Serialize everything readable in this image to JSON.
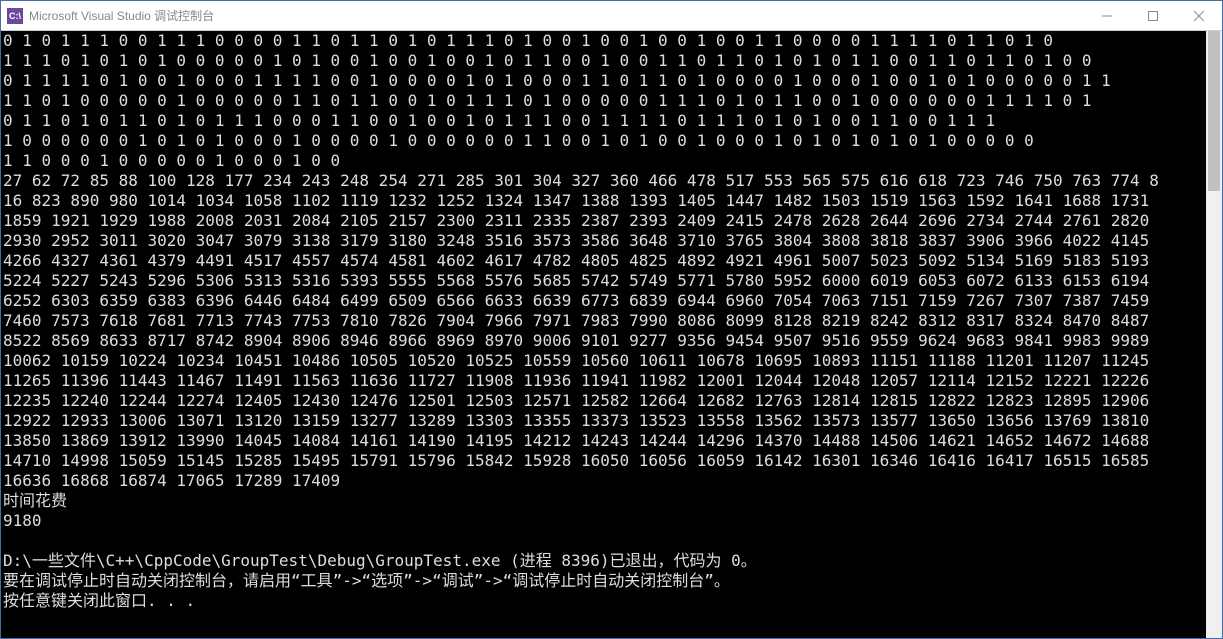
{
  "window": {
    "title": "Microsoft Visual Studio 调试控制台",
    "icon_label": "C:\\"
  },
  "console": {
    "lines": [
      "0 1 0 1 1 1 0 0 1 1 1 0 0 0 0 1 1 0 1 1 0 1 0 1 1 1 0 1 0 0 1 0 0 1 0 0 1 0 0 1 1 0 0 0 0 1 1 1 1 0 1 1 0 1 0",
      "1 1 1 0 1 0 1 0 1 0 0 0 0 0 1 0 1 0 0 1 0 0 1 0 0 1 0 1 1 0 0 1 0 0 1 1 0 1 1 0 1 0 1 0 1 1 0 0 1 1 0 1 1 0 1 0 0",
      "0 1 1 1 1 0 1 0 0 1 0 0 0 1 1 1 1 0 0 1 0 0 0 0 1 0 1 0 0 0 1 1 0 1 1 0 1 0 0 0 0 1 0 0 0 1 0 0 1 0 1 0 0 0 0 0 1 1",
      "1 1 0 1 0 0 0 0 0 1 0 0 0 0 0 1 1 0 1 1 0 0 1 0 1 1 1 0 1 0 0 0 0 0 1 1 1 0 1 0 1 1 0 0 1 0 0 0 0 0 0 1 1 1 1 0 1",
      "0 1 1 0 1 0 1 1 0 1 0 1 1 1 0 0 0 1 1 0 0 1 0 0 1 0 1 1 1 0 0 1 1 1 1 0 1 1 1 0 1 0 1 0 0 1 1 0 0 1 1 1",
      "1 0 0 0 0 0 0 1 0 1 0 1 0 0 0 1 0 0 0 0 1 0 0 0 0 0 0 1 1 0 0 1 0 1 0 0 1 0 0 0 1 0 1 0 1 0 1 0 1 0 0 0 0 0",
      "1 1 0 0 0 1 0 0 0 0 0 1 0 0 0 1 0 0",
      "27 62 72 85 88 100 128 177 234 243 248 254 271 285 301 304 327 360 466 478 517 553 565 575 616 618 723 746 750 763 774 8",
      "16 823 890 980 1014 1034 1058 1102 1119 1232 1252 1324 1347 1388 1393 1405 1447 1482 1503 1519 1563 1592 1641 1688 1731",
      "1859 1921 1929 1988 2008 2031 2084 2105 2157 2300 2311 2335 2387 2393 2409 2415 2478 2628 2644 2696 2734 2744 2761 2820",
      "2930 2952 3011 3020 3047 3079 3138 3179 3180 3248 3516 3573 3586 3648 3710 3765 3804 3808 3818 3837 3906 3966 4022 4145",
      "4266 4327 4361 4379 4491 4517 4557 4574 4581 4602 4617 4782 4805 4825 4892 4921 4961 5007 5023 5092 5134 5169 5183 5193",
      "5224 5227 5243 5296 5306 5313 5316 5393 5555 5568 5576 5685 5742 5749 5771 5780 5952 6000 6019 6053 6072 6133 6153 6194",
      "6252 6303 6359 6383 6396 6446 6484 6499 6509 6566 6633 6639 6773 6839 6944 6960 7054 7063 7151 7159 7267 7307 7387 7459",
      "7460 7573 7618 7681 7713 7743 7753 7810 7826 7904 7966 7971 7983 7990 8086 8099 8128 8219 8242 8312 8317 8324 8470 8487",
      "8522 8569 8633 8717 8742 8904 8906 8946 8966 8969 8970 9006 9101 9277 9356 9454 9507 9516 9559 9624 9683 9841 9983 9989",
      "10062 10159 10224 10234 10451 10486 10505 10520 10525 10559 10560 10611 10678 10695 10893 11151 11188 11201 11207 11245",
      "11265 11396 11443 11467 11491 11563 11636 11727 11908 11936 11941 11982 12001 12044 12048 12057 12114 12152 12221 12226",
      "12235 12240 12244 12274 12405 12430 12476 12501 12503 12571 12582 12664 12682 12763 12814 12815 12822 12823 12895 12906",
      "12922 12933 13006 13071 13120 13159 13277 13289 13303 13355 13373 13523 13558 13562 13573 13577 13650 13656 13769 13810",
      "13850 13869 13912 13990 14045 14084 14161 14190 14195 14212 14243 14244 14296 14370 14488 14506 14621 14652 14672 14688",
      "14710 14998 15059 15145 15285 15495 15791 15796 15842 15928 16050 16056 16059 16142 16301 16346 16416 16417 16515 16585",
      "16636 16868 16874 17065 17289 17409",
      "时间花费",
      "9180",
      "",
      "D:\\一些文件\\C++\\CppCode\\GroupTest\\Debug\\GroupTest.exe (进程 8396)已退出，代码为 0。",
      "要在调试停止时自动关闭控制台，请启用“工具”->“选项”->“调试”->“调试停止时自动关闭控制台”。",
      "按任意键关闭此窗口. . ."
    ]
  }
}
